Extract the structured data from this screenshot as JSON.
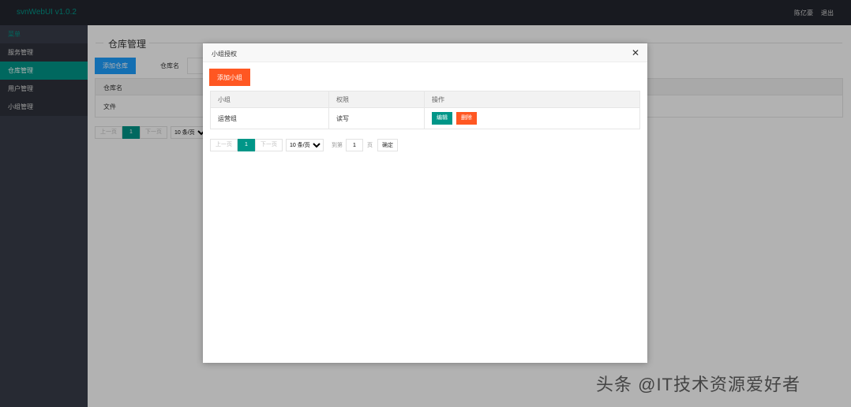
{
  "header": {
    "logo": "svnWebUI v1.0.2",
    "user": "陈亿豪",
    "logout": "退出"
  },
  "sidebar": {
    "title": "菜单",
    "items": [
      {
        "label": "服务管理"
      },
      {
        "label": "仓库管理"
      },
      {
        "label": "用户管理"
      },
      {
        "label": "小组管理"
      }
    ]
  },
  "main": {
    "section_title": "仓库管理",
    "add_repo_label": "添加仓库",
    "repo_name_label": "仓库名",
    "table": {
      "headers": [
        "仓库名"
      ],
      "rows": [
        [
          "文件"
        ]
      ]
    },
    "pager": {
      "prev": "上一页",
      "current": "1",
      "next": "下一页",
      "page_size": "10 条/页"
    }
  },
  "modal": {
    "title": "小组授权",
    "close_symbol": "✕",
    "add_group_label": "添加小组",
    "table": {
      "headers": [
        "小组",
        "权限",
        "操作"
      ],
      "rows": [
        {
          "group": "运营组",
          "permission": "读写",
          "edit_label": "编辑",
          "delete_label": "删除"
        }
      ]
    },
    "pager": {
      "prev": "上一页",
      "current": "1",
      "next": "下一页",
      "page_size": "10 条/页",
      "goto_label": "到第",
      "goto_value": "1",
      "goto_unit": "页",
      "confirm": "确定"
    }
  },
  "watermark": "头条 @IT技术资源爱好者",
  "colors": {
    "teal": "#009688",
    "orange": "#ff5722",
    "blue": "#1e9fff",
    "header_bg": "#23262e",
    "sidebar_bg": "#393d49"
  }
}
